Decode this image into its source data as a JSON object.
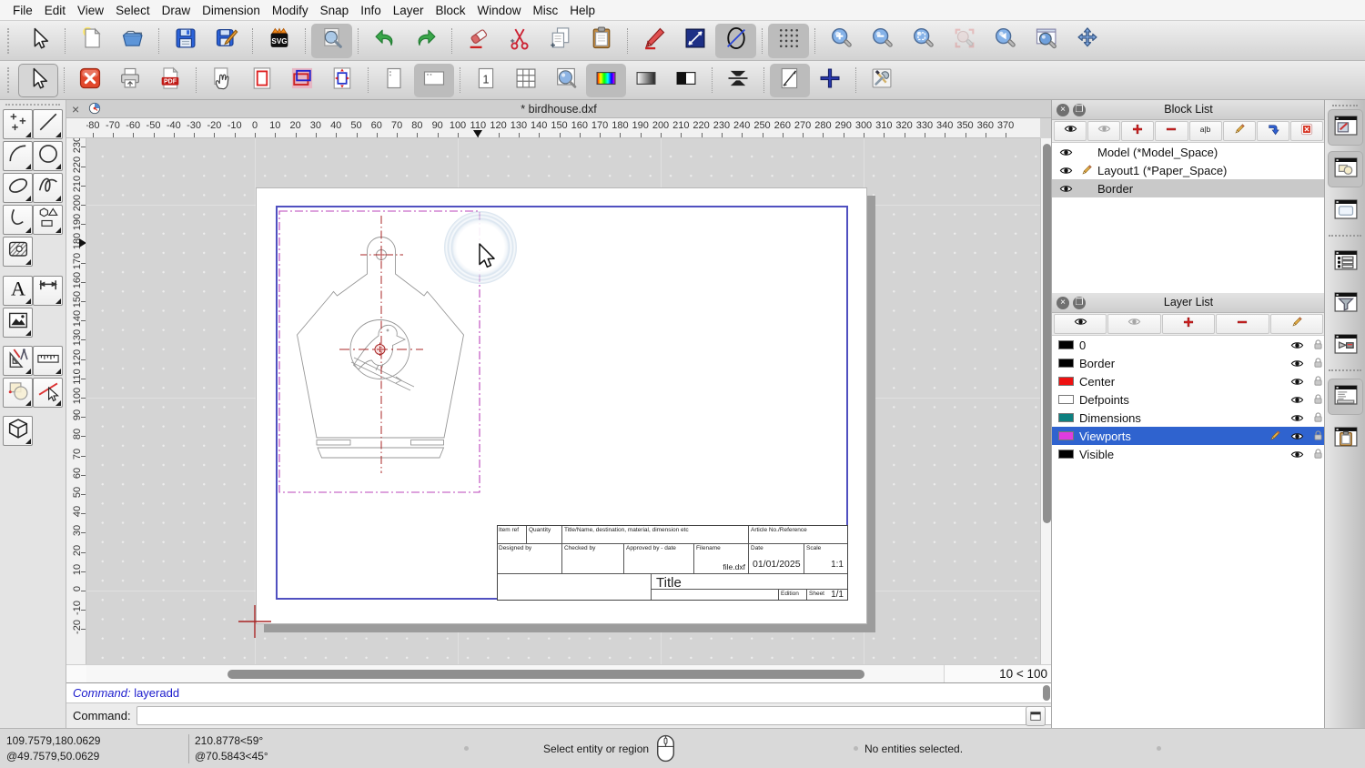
{
  "menu": {
    "items": [
      "File",
      "Edit",
      "View",
      "Select",
      "Draw",
      "Dimension",
      "Modify",
      "Snap",
      "Info",
      "Layer",
      "Block",
      "Window",
      "Misc",
      "Help"
    ]
  },
  "toolbar_top": {
    "items": [
      {
        "t": "btn",
        "name": "select-tool",
        "icon": "cursor"
      },
      {
        "t": "sep"
      },
      {
        "t": "btn",
        "name": "new-file",
        "icon": "new"
      },
      {
        "t": "btn",
        "name": "open-file",
        "icon": "open"
      },
      {
        "t": "sep"
      },
      {
        "t": "btn",
        "name": "save",
        "icon": "save"
      },
      {
        "t": "btn",
        "name": "save-as",
        "icon": "saveas"
      },
      {
        "t": "sep"
      },
      {
        "t": "btn",
        "name": "export-svg",
        "icon": "svg"
      },
      {
        "t": "sep"
      },
      {
        "t": "btn",
        "name": "print-preview",
        "icon": "preview",
        "sel": true
      },
      {
        "t": "sep"
      },
      {
        "t": "btn",
        "name": "undo",
        "icon": "undo"
      },
      {
        "t": "btn",
        "name": "redo",
        "icon": "redo"
      },
      {
        "t": "sep"
      },
      {
        "t": "btn",
        "name": "erase",
        "icon": "eraser"
      },
      {
        "t": "btn",
        "name": "cut",
        "icon": "cut"
      },
      {
        "t": "btn",
        "name": "copy",
        "icon": "copy"
      },
      {
        "t": "btn",
        "name": "paste",
        "icon": "paste"
      },
      {
        "t": "sep"
      },
      {
        "t": "btn",
        "name": "draw-edit",
        "icon": "pencil"
      },
      {
        "t": "btn",
        "name": "line-settings",
        "icon": "navydiag"
      },
      {
        "t": "btn",
        "name": "draw-ellipse",
        "icon": "ellipseslash",
        "sel": true
      },
      {
        "t": "sep"
      },
      {
        "t": "btn",
        "name": "grid-toggle",
        "icon": "griddots",
        "sel": true
      },
      {
        "t": "sep"
      },
      {
        "t": "btn",
        "name": "zoom-in",
        "icon": "zin"
      },
      {
        "t": "btn",
        "name": "zoom-out",
        "icon": "zout"
      },
      {
        "t": "btn",
        "name": "zoom-auto",
        "icon": "zfit"
      },
      {
        "t": "btn",
        "name": "zoom-selection",
        "icon": "zsel",
        "dis": true
      },
      {
        "t": "btn",
        "name": "zoom-previous",
        "icon": "zprev"
      },
      {
        "t": "btn",
        "name": "zoom-window",
        "icon": "zwin"
      },
      {
        "t": "btn",
        "name": "pan",
        "icon": "pan"
      }
    ]
  },
  "toolbar_second": {
    "items": [
      {
        "t": "btn",
        "name": "select-tool-2",
        "icon": "cursor",
        "box": true
      },
      {
        "t": "sep"
      },
      {
        "t": "btn",
        "name": "close-print-preview",
        "icon": "closex"
      },
      {
        "t": "btn",
        "name": "print",
        "icon": "print"
      },
      {
        "t": "btn",
        "name": "export-pdf",
        "icon": "pdf"
      },
      {
        "t": "sep"
      },
      {
        "t": "btn",
        "name": "move-paper-position",
        "icon": "handpage"
      },
      {
        "t": "btn",
        "name": "print-area",
        "icon": "pagered"
      },
      {
        "t": "btn",
        "name": "draw-border",
        "icon": "overlap"
      },
      {
        "t": "btn",
        "name": "fit-viewport",
        "icon": "vparrows"
      },
      {
        "t": "sep"
      },
      {
        "t": "btn",
        "name": "portrait",
        "icon": "portrait"
      },
      {
        "t": "btn",
        "name": "landscape",
        "icon": "landscape",
        "sel": true
      },
      {
        "t": "sep"
      },
      {
        "t": "btn",
        "name": "single-page",
        "icon": "page1"
      },
      {
        "t": "btn",
        "name": "multiple-pages",
        "icon": "pagesgrid"
      },
      {
        "t": "btn",
        "name": "zoom-to-page",
        "icon": "zoompage"
      },
      {
        "t": "btn",
        "name": "full-color",
        "icon": "colorbar",
        "sel": true
      },
      {
        "t": "btn",
        "name": "grayscale",
        "icon": "graybar"
      },
      {
        "t": "btn",
        "name": "black-white",
        "icon": "bwbar"
      },
      {
        "t": "sep"
      },
      {
        "t": "btn",
        "name": "auto-fit-drawing",
        "icon": "compress"
      },
      {
        "t": "sep"
      },
      {
        "t": "btn",
        "name": "drawing-settings",
        "icon": "pagediag",
        "sel": true
      },
      {
        "t": "btn",
        "name": "points-toggle",
        "icon": "crossblue"
      },
      {
        "t": "sep"
      },
      {
        "t": "btn",
        "name": "preferences",
        "icon": "tools"
      }
    ]
  },
  "palette": {
    "rows": [
      [
        "point-tools",
        "line-tools"
      ],
      [
        "arc-tools",
        "circle-tools"
      ],
      [
        "ellipse-tools",
        "spline-tools"
      ],
      [
        "polyline-tools",
        "shape-tools"
      ],
      [
        "hatch-tools",
        null
      ],
      [
        "text-tools",
        "dimension-tools"
      ],
      [
        "image-tools",
        null
      ],
      [
        "draw-misc-tools",
        "measure-tools"
      ],
      [
        "modify-tools",
        "select-tools"
      ],
      [
        "solid-tools",
        null
      ]
    ],
    "icons": {
      "point-tools": "points",
      "line-tools": "line",
      "arc-tools": "arc",
      "circle-tools": "circle",
      "ellipse-tools": "ellipse",
      "spline-tools": "spline",
      "polyline-tools": "polyline",
      "shape-tools": "shapes",
      "hatch-tools": "hatch",
      "text-tools": "text",
      "dimension-tools": "dim",
      "image-tools": "image",
      "draw-misc-tools": "drawmisc",
      "measure-tools": "ruler",
      "modify-tools": "modify",
      "select-tools": "selectline",
      "solid-tools": "box3d"
    }
  },
  "doc": {
    "tab_title": "* birdhouse.dxf",
    "close_glyph": "×"
  },
  "ruler": {
    "h": {
      "labels": [
        -80,
        -70,
        -60,
        -50,
        -40,
        -30,
        -20,
        -10,
        0,
        10,
        20,
        30,
        40,
        50,
        60,
        70,
        80,
        90,
        100,
        110,
        120,
        130,
        140,
        150,
        160,
        170,
        180,
        190,
        200,
        210,
        220,
        230,
        240,
        250,
        260,
        270,
        280,
        290,
        300,
        310,
        320,
        330,
        340,
        350,
        360,
        370
      ],
      "marker": 110
    },
    "v": {
      "labels": [
        230,
        220,
        210,
        200,
        190,
        180,
        170,
        160,
        150,
        140,
        130,
        120,
        110,
        100,
        90,
        80,
        70,
        60,
        50,
        40,
        30,
        20,
        10,
        0,
        -10,
        -20
      ],
      "marker": 180
    }
  },
  "scroll": {
    "grid_status": "10 < 100"
  },
  "panels": {
    "block_list": {
      "title": "Block List",
      "toolbar": [
        {
          "name": "show-all-blocks",
          "icon": "eye"
        },
        {
          "name": "hide-all-blocks",
          "icon": "eyeoff"
        },
        {
          "name": "add-block",
          "icon": "plus"
        },
        {
          "name": "remove-block",
          "icon": "minus"
        },
        {
          "name": "rename-block",
          "icon": "rename"
        },
        {
          "name": "edit-block",
          "icon": "pencil16"
        },
        {
          "name": "insert-block",
          "icon": "insert"
        },
        {
          "name": "delete-block",
          "icon": "delbox"
        }
      ],
      "items": [
        {
          "label": "Model (*Model_Space)",
          "pencil": false,
          "selected": false
        },
        {
          "label": "Layout1 (*Paper_Space)",
          "pencil": true,
          "selected": false
        },
        {
          "label": "Border",
          "pencil": false,
          "selected": true
        }
      ]
    },
    "layer_list": {
      "title": "Layer List",
      "toolbar": [
        {
          "name": "show-all-layers",
          "icon": "eye"
        },
        {
          "name": "hide-all-layers",
          "icon": "eyeoff"
        },
        {
          "name": "add-layer",
          "icon": "plus"
        },
        {
          "name": "remove-layer",
          "icon": "minus"
        },
        {
          "name": "edit-layer",
          "icon": "pencil16"
        }
      ],
      "layers": [
        {
          "name": "0",
          "color": "#000000",
          "selected": false
        },
        {
          "name": "Border",
          "color": "#000000",
          "selected": false
        },
        {
          "name": "Center",
          "color": "#ee1111",
          "selected": false
        },
        {
          "name": "Defpoints",
          "color": "#ffffff",
          "selected": false
        },
        {
          "name": "Dimensions",
          "color": "#0d8080",
          "selected": false
        },
        {
          "name": "Viewports",
          "color": "#e03ce0",
          "selected": true,
          "editing": true
        },
        {
          "name": "Visible",
          "color": "#000000",
          "selected": false
        }
      ]
    }
  },
  "side_strip": {
    "buttons": [
      {
        "name": "property-editor",
        "icon": "win-prop",
        "sel": true
      },
      {
        "name": "block-list-toggle",
        "icon": "win-blocks",
        "sel": true
      },
      {
        "name": "library-browser",
        "icon": "win-library",
        "sel": false
      },
      {
        "name": "layer-list-toggle",
        "icon": "win-list",
        "sel": false
      },
      {
        "name": "selection-filter",
        "icon": "win-filter",
        "sel": false
      },
      {
        "name": "view-toggle",
        "icon": "win-view",
        "sel": false
      },
      {
        "name": "command-line-toggle",
        "icon": "win-command",
        "sel": true
      },
      {
        "name": "clipboard-toggle",
        "icon": "win-clipboard",
        "sel": false
      }
    ]
  },
  "title_block": {
    "item_ref": "Item ref",
    "quantity": "Quantity",
    "title_name": "Title/Name, destination, material, dimension etc",
    "article": "Article No./Reference",
    "designed": "Designed by",
    "checked": "Checked by",
    "approved": "Approved by - date",
    "filename_label": "Filename",
    "filename_value": "file.dxf",
    "date_label": "Date",
    "date_value": "01/01/2025",
    "scale_label": "Scale",
    "scale_value": "1:1",
    "title_label": "Title",
    "edition_label": "Edition",
    "sheet_label": "Sheet",
    "sheet_value": "1/1"
  },
  "command": {
    "history_label": "Command:",
    "history_value": " layeradd",
    "input_label": "Command:"
  },
  "status": {
    "coord_abs": "109.7579,180.0629",
    "coord_rel": "@49.7579,50.0629",
    "polar_abs": "210.8778<59°",
    "polar_rel": "@70.5843<45°",
    "hint": "Select entity or region",
    "selection": "No entities selected."
  }
}
